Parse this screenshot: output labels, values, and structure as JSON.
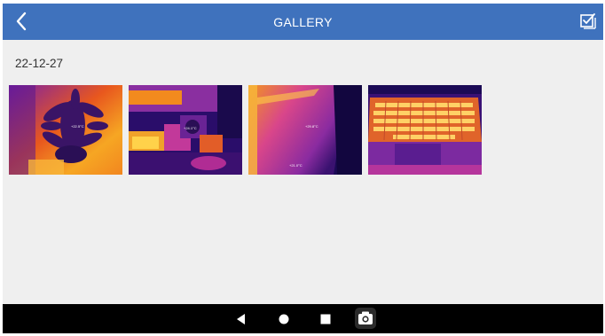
{
  "header": {
    "title": "GALLERY",
    "back_icon": "chevron-left-icon",
    "select_icon": "select-checkbox-icon",
    "background": "#3f72bd"
  },
  "gallery": {
    "date": "22-12-27",
    "images": [
      {
        "name": "thermal-plant"
      },
      {
        "name": "thermal-desk-camera"
      },
      {
        "name": "thermal-device-panel"
      },
      {
        "name": "thermal-laptop-keyboard"
      }
    ]
  },
  "navbar": {
    "icons": [
      "back-triangle-icon",
      "home-circle-icon",
      "recents-square-icon",
      "camera-icon"
    ]
  },
  "colors": {
    "thermal_cold": "#1b0a55",
    "thermal_mid": "#b3239a",
    "thermal_warm": "#f27a1d",
    "thermal_hot": "#ffd83a"
  }
}
